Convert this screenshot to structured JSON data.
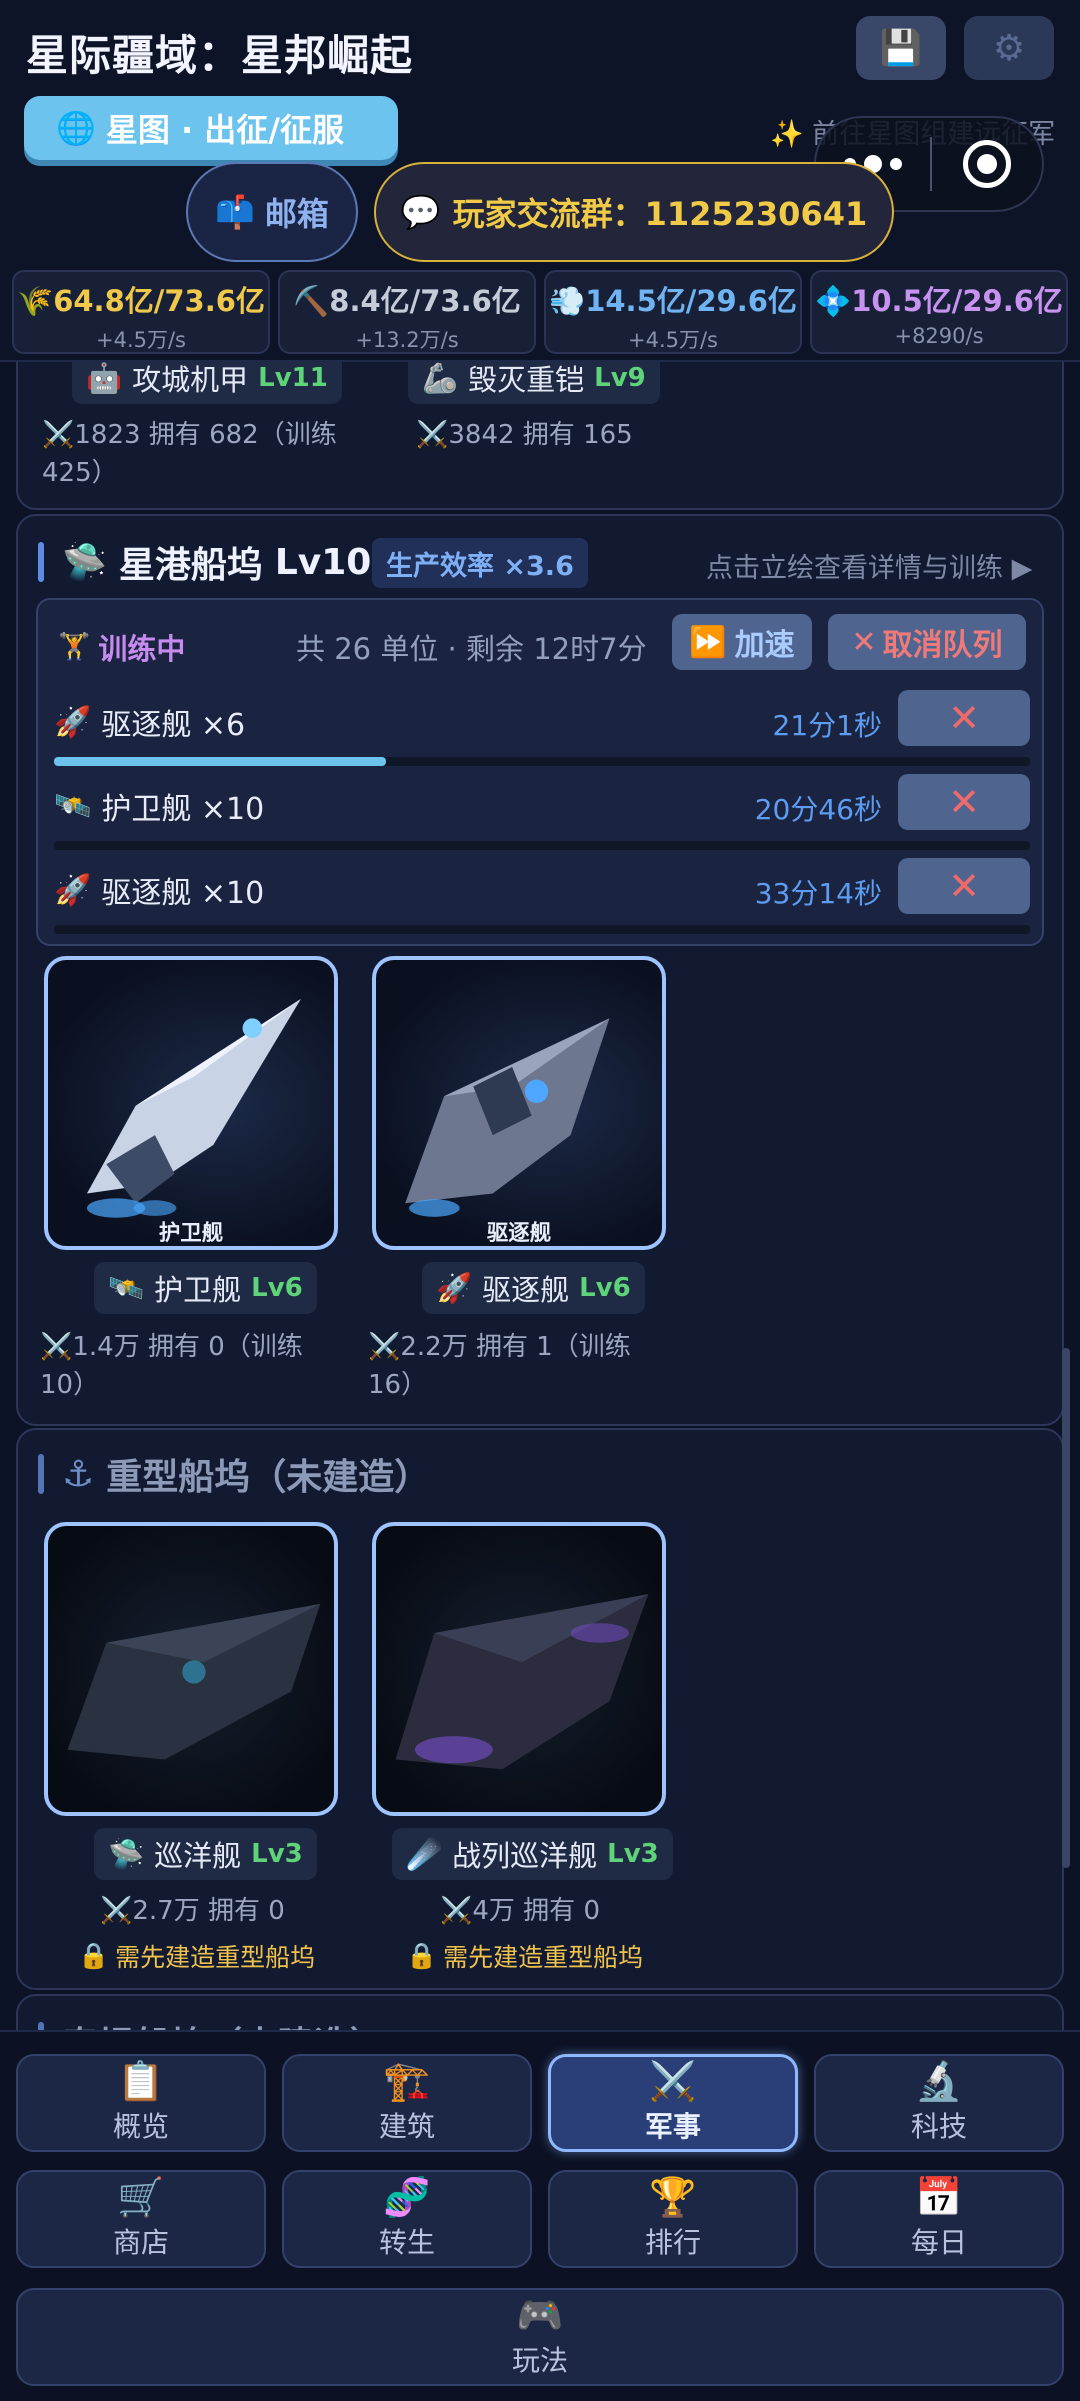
{
  "header": {
    "title": "星际疆域：星邦崛起",
    "starmap_button": "星图 · 出征/征服",
    "starmap_hint": "✨ 前往星图组建远征军",
    "mail_button": "邮箱",
    "group_button": "玩家交流群：1125230641",
    "colors": {
      "accent": "#6cc3ee",
      "gold": "#f1cb48"
    }
  },
  "resources": [
    {
      "value": "64.8亿/73.6亿",
      "rate": "+4.5万/s",
      "icon": "wheat-icon",
      "color": "#f0c84a"
    },
    {
      "value": "8.4亿/73.6亿",
      "rate": "+13.2万/s",
      "icon": "pickaxe-icon",
      "color": "#c6cbd8"
    },
    {
      "value": "14.5亿/29.6亿",
      "rate": "+4.5万/s",
      "icon": "wind-icon",
      "color": "#6fb3f2"
    },
    {
      "value": "10.5亿/29.6亿",
      "rate": "+8290/s",
      "icon": "crystal-icon",
      "color": "#c792f0"
    }
  ],
  "prev_section": {
    "units": [
      {
        "name": "攻城机甲",
        "level": "Lv11",
        "stat": "⚔️1823  拥有 682（训练 425）"
      },
      {
        "name": "毁灭重铠",
        "level": "Lv9",
        "stat": "⚔️3842  拥有 165"
      }
    ]
  },
  "starport": {
    "title": "星港船坞",
    "level": "Lv10",
    "efficiency": "生产效率 ×3.6",
    "detail_link": "点击立绘查看详情与训练 ▶",
    "queue": {
      "status": "训练中",
      "info": "共 26 单位 · 剩余 12时7分",
      "speed_label": "加速",
      "cancel_label": "取消队列",
      "items": [
        {
          "name": "驱逐舰 ×6",
          "time": "21分1秒",
          "progress": 0.34
        },
        {
          "name": "护卫舰 ×10",
          "time": "20分46秒",
          "progress": 0
        },
        {
          "name": "驱逐舰 ×10",
          "time": "33分14秒",
          "progress": 0
        }
      ]
    },
    "ships": [
      {
        "name": "护卫舰",
        "level": "Lv6",
        "stat": "⚔️1.4万  拥有 0（训练 10）",
        "caption": "护卫舰"
      },
      {
        "name": "驱逐舰",
        "level": "Lv6",
        "stat": "⚔️2.2万  拥有 1（训练 16）",
        "caption": "驱逐舰"
      }
    ]
  },
  "heavy_dock": {
    "title": "重型船坞（未建造）",
    "ships": [
      {
        "name": "巡洋舰",
        "level": "Lv3",
        "stat": "⚔️2.7万  拥有 0",
        "lock": "需先建造重型船坞"
      },
      {
        "name": "战列巡洋舰",
        "level": "Lv3",
        "stat": "⚔️4万  拥有 0",
        "lock": "需先建造重型船坞"
      }
    ],
    "next_title": "泰坦船坞（未建造）"
  },
  "nav": [
    {
      "label": "概览",
      "icon": "clipboard-icon"
    },
    {
      "label": "建筑",
      "icon": "crane-icon"
    },
    {
      "label": "军事",
      "icon": "swords-icon"
    },
    {
      "label": "科技",
      "icon": "microscope-icon"
    },
    {
      "label": "商店",
      "icon": "cart-icon"
    },
    {
      "label": "转生",
      "icon": "dna-icon"
    },
    {
      "label": "排行",
      "icon": "trophy-icon"
    },
    {
      "label": "每日",
      "icon": "calendar-icon"
    },
    {
      "label": "玩法",
      "icon": "gamepad-icon"
    }
  ]
}
